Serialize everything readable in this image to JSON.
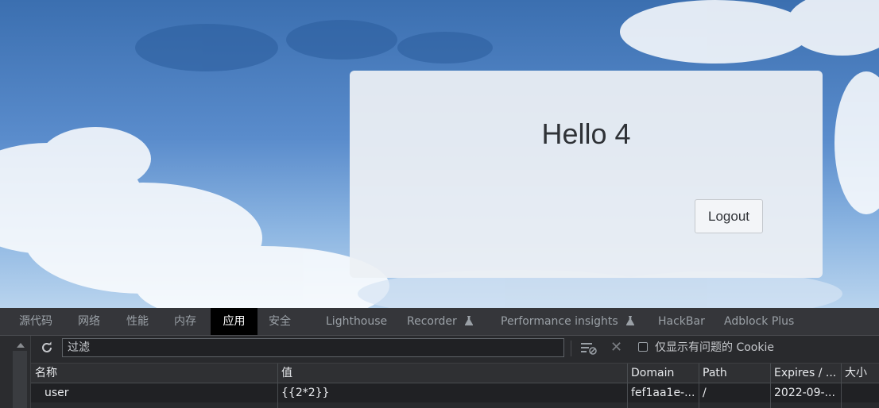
{
  "page": {
    "greeting": "Hello 4",
    "logout_label": "Logout"
  },
  "devtools": {
    "tabs": [
      {
        "label": "源代码"
      },
      {
        "label": "网络"
      },
      {
        "label": "性能"
      },
      {
        "label": "内存"
      },
      {
        "label": "应用",
        "active": true
      },
      {
        "label": "安全"
      },
      {
        "label": "Lighthouse"
      },
      {
        "label": "Recorder",
        "icon": "flask-icon"
      },
      {
        "label": "Performance insights",
        "icon": "flask-icon"
      },
      {
        "label": "HackBar"
      },
      {
        "label": "Adblock Plus"
      }
    ],
    "toolbar": {
      "refresh_icon": "refresh-icon",
      "filter_placeholder": "过滤",
      "clear_filter_icon": "clear-filter-icon",
      "delete_icon": "delete-icon",
      "only_issues_label": "仅显示有问题的 Cookie",
      "only_issues_checked": false
    },
    "cookie_table": {
      "columns": [
        "名称",
        "值",
        "Domain",
        "Path",
        "Expires / ...",
        "大小"
      ],
      "rows": [
        [
          "user",
          "{{2*2}}",
          "fef1aa1e-...",
          "/",
          "2022-09-...",
          ""
        ]
      ]
    }
  },
  "colors": {
    "devtools_bg": "#282a2d",
    "active_tab_bg": "#000000",
    "card_bg": "#edf0f4"
  }
}
